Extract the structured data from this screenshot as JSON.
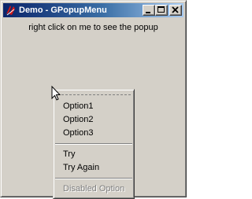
{
  "window": {
    "title": "Demo - GPopupMenu",
    "icon": "tk-feather-icon"
  },
  "titlebar_buttons": {
    "minimize": "minimize-icon",
    "maximize": "maximize-icon",
    "close": "close-icon"
  },
  "client": {
    "hint_text": "right click on me to see the popup"
  },
  "popup": {
    "group1": [
      "Option1",
      "Option2",
      "Option3"
    ],
    "group2": [
      "Try",
      "Try Again"
    ],
    "group3": [
      "Disabled Option"
    ],
    "disabled_color": "#808080"
  },
  "colors": {
    "titlebar_start": "#0a246a",
    "titlebar_end": "#a6caf0",
    "face": "#d4d0c8"
  }
}
